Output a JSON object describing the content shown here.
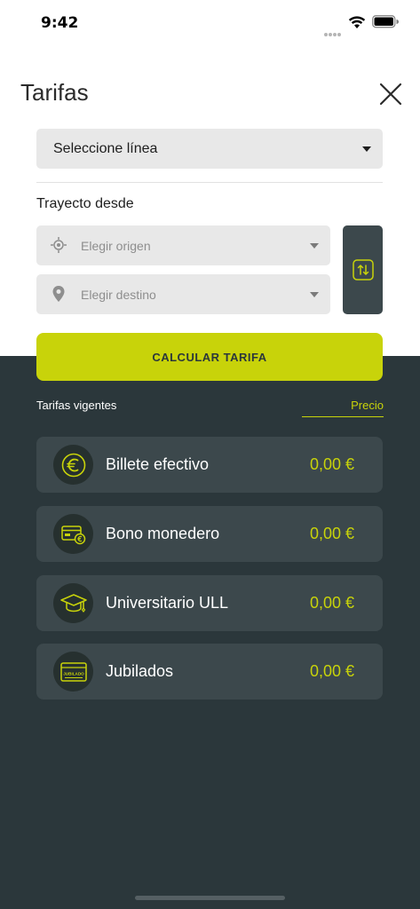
{
  "status_bar": {
    "time": "9:42"
  },
  "header": {
    "title": "Tarifas"
  },
  "line_select": {
    "label": "Seleccione línea"
  },
  "route": {
    "section_label": "Trayecto desde",
    "origin_placeholder": "Elegir origen",
    "destination_placeholder": "Elegir destino"
  },
  "calculate": {
    "label": "CALCULAR TARIFA"
  },
  "tariffs": {
    "title": "Tarifas vigentes",
    "price_tab": "Precio",
    "items": [
      {
        "name": "Billete efectivo",
        "price": "0,00 €",
        "icon": "euro-icon"
      },
      {
        "name": "Bono monedero",
        "price": "0,00 €",
        "icon": "wallet-card-icon"
      },
      {
        "name": "Universitario ULL",
        "price": "0,00 €",
        "icon": "graduation-cap-icon"
      },
      {
        "name": "Jubilados",
        "price": "0,00 €",
        "icon": "jubilado-card-icon",
        "card_text": "JUBILADO"
      }
    ]
  },
  "colors": {
    "accent": "#c8d30a",
    "dark_bg": "#2b373b",
    "card_bg": "#3c484c",
    "field_bg": "#e8e8e8"
  }
}
